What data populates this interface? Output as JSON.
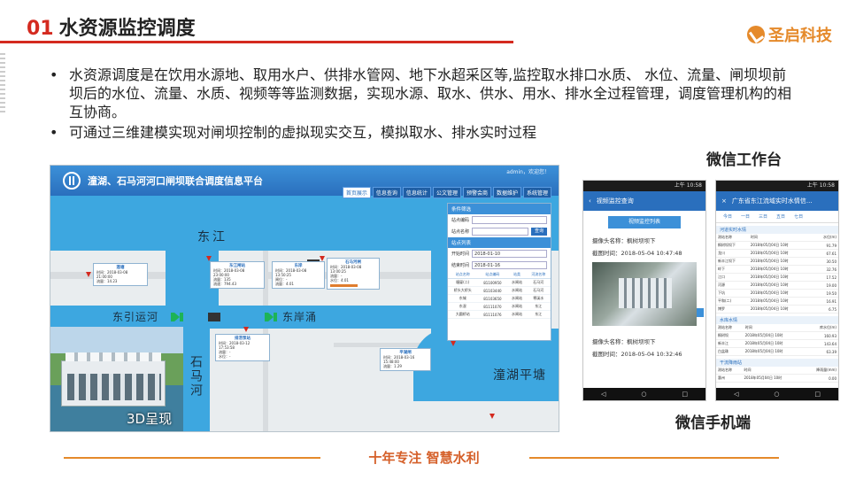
{
  "header": {
    "number": "01",
    "title": "水资源监控调度",
    "logo_text": "圣启科技"
  },
  "bullets": [
    "水资源调度是在饮用水源地、取用水户、供排水管网、地下水超采区等,监控取水排口水质、 水位、流量、闸坝坝前坝后的水位、流量、水质、视频等等监测数据，实现水源、取水、供水、用水、排水全过程管理，调度管理机构的相互协商。",
    "可通过三维建模实现对闸坝控制的虚拟现实交互，模拟取水、排水实时过程"
  ],
  "captions": {
    "wechat_workbench": "微信工作台",
    "wechat_mobile": "微信手机端"
  },
  "platform": {
    "title": "潼湖、石马河河口闸坝联合调度信息平台",
    "user": "admin，欢迎您！",
    "nav": [
      "首页展示",
      "信息查询",
      "信息统计",
      "公文管理",
      "预警会商",
      "数据维护",
      "系统管理"
    ],
    "map_labels": {
      "dongjiang": "东江",
      "dongyinyunhe": "东引运河",
      "dongancong": "东岸涌",
      "shimahe": "石马河",
      "tonghu": "潼湖平塘"
    },
    "render_label": "3D呈现",
    "infoboxes": [
      {
        "title": "东江闸站",
        "lines": [
          "时间：2018-03-08 23:00:00",
          "流量：135",
          "流速：794.43"
        ]
      },
      {
        "title": "东岸",
        "lines": [
          "时间：2018-03-08 13:50:25",
          "闸位：-",
          "流量：4.01"
        ]
      },
      {
        "title": "石马河闸",
        "lines": [
          "时间：2018-03-08 13:00:25",
          "流量：-",
          "水位：4.01"
        ]
      },
      {
        "title": "莲塘",
        "lines": [
          "时间：2018-03-08 21:00:00",
          "流量：14.23"
        ]
      },
      {
        "title": "排涝泵站",
        "lines": [
          "时间：2018-03-12 17:53:58",
          "流量：-",
          "水位：-"
        ]
      },
      {
        "title": "平湖闸",
        "lines": [
          "时间：2018-03-16 15:48:00",
          "流量：1.29"
        ]
      }
    ],
    "panel": {
      "filter_title": "条件筛选",
      "station_code_label": "站点编码",
      "station_name_label": "站点名称",
      "query_button": "查询",
      "list_title": "站点列表",
      "start_label": "开始时间",
      "start_value": "2018-01-10",
      "end_label": "结束时间",
      "end_value": "2018-01-16",
      "columns": [
        "站点名称",
        "站点编码",
        "站类",
        "河流名称"
      ],
      "rows": [
        [
          "塘厦(二)",
          "81100950",
          "水闸站",
          "石马河"
        ],
        [
          "桥头大桥头",
          "81103440",
          "水闸站",
          "石马河"
        ],
        [
          "东城",
          "81103650",
          "水闸站",
          "寒溪水"
        ],
        [
          "东滘",
          "81111070",
          "水闸站",
          "东江"
        ],
        [
          "大圆桥站",
          "81111076",
          "水闸站",
          "东江"
        ]
      ]
    }
  },
  "phone1": {
    "status": "上午 10:58",
    "bar_title": "视频监控查询",
    "tab_button": "视频监控列表",
    "items": [
      {
        "name": "摄像头名称：枫树坝坝下",
        "time": "截图时间：2018-05-04 10:47:48"
      },
      {
        "name": "摄像头名称：枫树坝坝下",
        "time": "截图时间：2018-05-04 10:32:46"
      }
    ]
  },
  "phone2": {
    "status": "上午 10:58",
    "bar_title": "广东省东江流域实时水情信...",
    "tabs": [
      "今日",
      "一日",
      "三日",
      "五日",
      "七日"
    ],
    "sections": [
      {
        "title": "河道实时水情",
        "cols": [
          "测站名称",
          "时间",
          "水位(m)"
        ],
        "rows": [
          [
            "枫树坝坝下",
            "2018年05月04日 10时",
            "91.79"
          ],
          [
            "龙川",
            "2018年05月04日 10时",
            "67.61"
          ],
          [
            "新丰江坝下",
            "2018年05月04日 10时",
            "30.50"
          ],
          [
            "岭下",
            "2018年05月04日 10时",
            "32.76"
          ],
          [
            "江口",
            "2018年05月04日 10时",
            "17.52"
          ],
          [
            "河源",
            "2018年05月04日 10时",
            "19.00"
          ],
          [
            "下坑",
            "2018年05月04日 10时",
            "19.50"
          ],
          [
            "平和(二)",
            "2018年05月04日 10时",
            "16.91"
          ],
          [
            "博罗",
            "2018年05月04日 10时",
            "6.75"
          ]
        ]
      },
      {
        "title": "水库水情",
        "cols": [
          "测站名称",
          "时间",
          "库水位(m)"
        ],
        "rows": [
          [
            "枫树坝",
            "2018年05月04日 10时",
            "160.93"
          ],
          [
            "新丰江",
            "2018年05月04日 10时",
            "143.64"
          ],
          [
            "白盆珠",
            "2018年05月04日 10时",
            "63.39"
          ]
        ]
      },
      {
        "title": "干流降雨站",
        "cols": [
          "测站名称",
          "时间",
          "降雨量(mm)"
        ],
        "rows": [
          [
            "惠州",
            "2018年05月04日 10时",
            "0.00"
          ]
        ]
      }
    ]
  },
  "footer": {
    "slogan": "十年专注  智慧水利"
  }
}
